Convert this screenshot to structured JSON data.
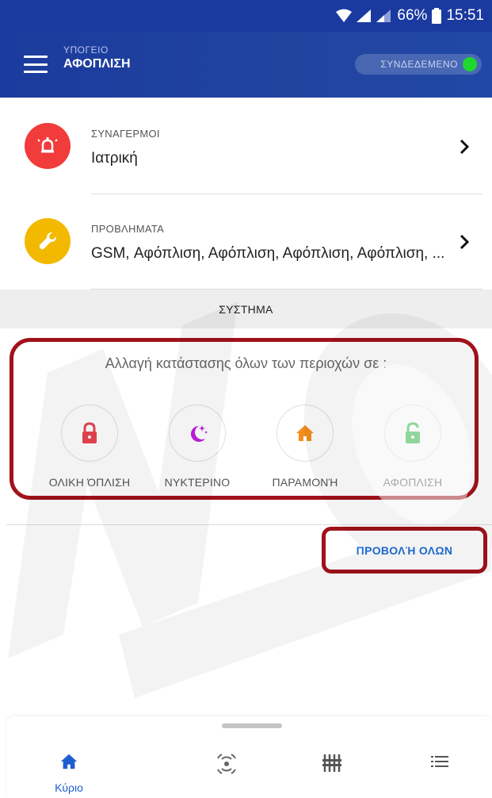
{
  "status_bar": {
    "battery": "66%",
    "time": "15:51"
  },
  "header": {
    "subtitle": "ΥΠΟΓΕΙΟ",
    "title": "ΑΦΟΠΛΙΣΗ",
    "connection_label": "ΣΥΝΔΕΔΕΜΕΝΟ",
    "connection_color": "#1fd82f"
  },
  "alarms": {
    "label": "ΣΥΝΑΓΕΡΜΟΙ",
    "value": "Ιατρική",
    "icon": "alarm-bell-icon",
    "color": "#f23b3b"
  },
  "problems": {
    "label": "ΠΡΟΒΛΗΜΑΤΑ",
    "value": "GSM, Αφόπλιση, Αφόπλιση, Αφόπλιση, Αφόπλιση, ...",
    "icon": "wrench-icon",
    "color": "#f2b900"
  },
  "system_bar": {
    "label": "ΣΥΣΤΗΜΑ"
  },
  "modes": {
    "heading": "Αλλαγή κατάστασης όλων των περιοχών σε :",
    "items": [
      {
        "label": "ΟΛΙΚΗ ΌΠΛΙΣΗ",
        "icon": "lock-icon",
        "color": "#e8454e"
      },
      {
        "label": "ΝΥΚΤΕΡΙΝΟ",
        "icon": "moon-stars-icon",
        "color": "#c21ee0"
      },
      {
        "label": "ΠΑΡΑΜΟΝΉ",
        "icon": "home-icon",
        "color": "#f58e1c"
      },
      {
        "label": "ΑΦΟΠΛΙΣΗ",
        "icon": "unlock-icon",
        "color": "#1fb53c"
      }
    ]
  },
  "view_all": {
    "label": "ΠΡΟΒΟΛΉ ΟΛΩΝ"
  },
  "bottom_nav": {
    "items": [
      {
        "label": "Κύριο",
        "icon": "home-icon"
      },
      {
        "label": "",
        "icon": "radar-icon"
      },
      {
        "label": "",
        "icon": "equalizer-icon"
      },
      {
        "label": "",
        "icon": "list-icon"
      }
    ],
    "active_color": "#1e5fd0"
  }
}
